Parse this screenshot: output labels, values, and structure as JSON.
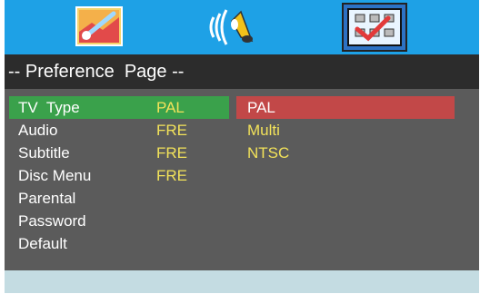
{
  "tabs": [
    {
      "icon": "tools-picture-icon"
    },
    {
      "icon": "speaker-audio-icon"
    },
    {
      "icon": "checklist-preference-icon",
      "active": true
    }
  ],
  "page_title": "-- Preference  Page --",
  "menu": [
    {
      "label": "TV  Type",
      "value": "PAL",
      "active": true
    },
    {
      "label": "Audio",
      "value": "FRE"
    },
    {
      "label": "Subtitle",
      "value": "FRE"
    },
    {
      "label": "Disc Menu",
      "value": "FRE"
    },
    {
      "label": "Parental",
      "value": ""
    },
    {
      "label": "Password",
      "value": ""
    },
    {
      "label": "Default",
      "value": ""
    }
  ],
  "options": [
    {
      "label": "PAL",
      "selected": true
    },
    {
      "label": "Multi"
    },
    {
      "label": "NTSC"
    }
  ],
  "colors": {
    "topbar": "#1ea1e6",
    "panel": "#5b5b5b",
    "highlight_menu": "#3aa14b",
    "highlight_option": "#c24848",
    "value_text": "#f2e25a"
  }
}
